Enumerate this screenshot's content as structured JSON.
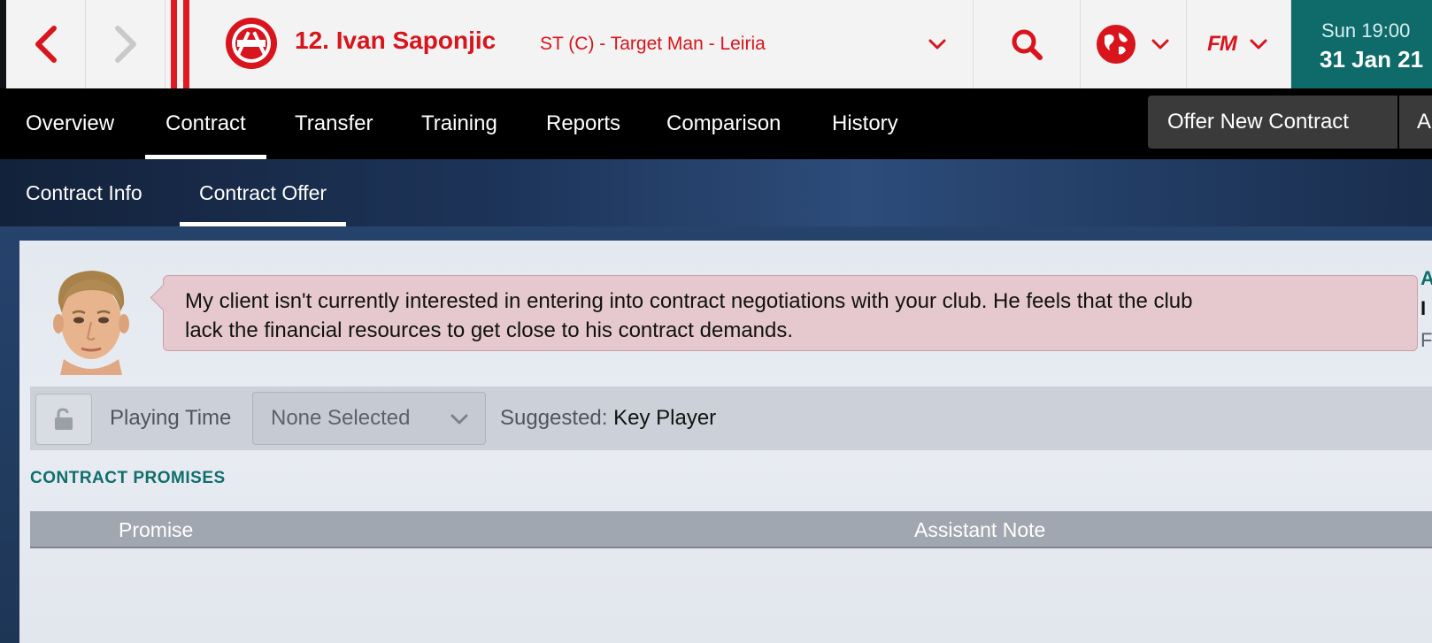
{
  "header": {
    "player_name": "12. Ivan Saponjic",
    "player_meta": "ST (C) - Target Man - Leiria",
    "fm_logo": "FM",
    "time": "Sun 19:00",
    "date": "31 Jan 21",
    "icons": [
      "back-arrow-icon",
      "forward-arrow-icon",
      "club-crest-icon",
      "chevron-down-icon",
      "search-icon",
      "globe-icon",
      "fm-logo"
    ],
    "accent_color": "#d8141c",
    "date_bg_color": "#0e6b6a"
  },
  "tabs": [
    {
      "label": "Overview"
    },
    {
      "label": "Contract"
    },
    {
      "label": "Transfer"
    },
    {
      "label": "Training"
    },
    {
      "label": "Reports"
    },
    {
      "label": "Comparison"
    },
    {
      "label": "History"
    }
  ],
  "active_tab": "Contract",
  "actions": {
    "offer_label": "Offer New Contract",
    "extra_label": "A"
  },
  "subtabs": [
    {
      "label": "Contract Info"
    },
    {
      "label": "Contract Offer"
    }
  ],
  "active_subtab": "Contract Offer",
  "agent_message": {
    "line1": "My client isn't currently interested in entering into contract negotiations with your club. He feels that the club",
    "line2": "lack the financial resources to get close to his contract demands."
  },
  "side_fragments": [
    "A",
    "I",
    "F"
  ],
  "playing_time": {
    "label": "Playing Time",
    "selected": "None Selected",
    "suggested_label": "Suggested:",
    "suggested_value": "Key Player"
  },
  "promises": {
    "section_title": "CONTRACT PROMISES",
    "columns": [
      "Promise",
      "Assistant Note"
    ],
    "rows": []
  }
}
